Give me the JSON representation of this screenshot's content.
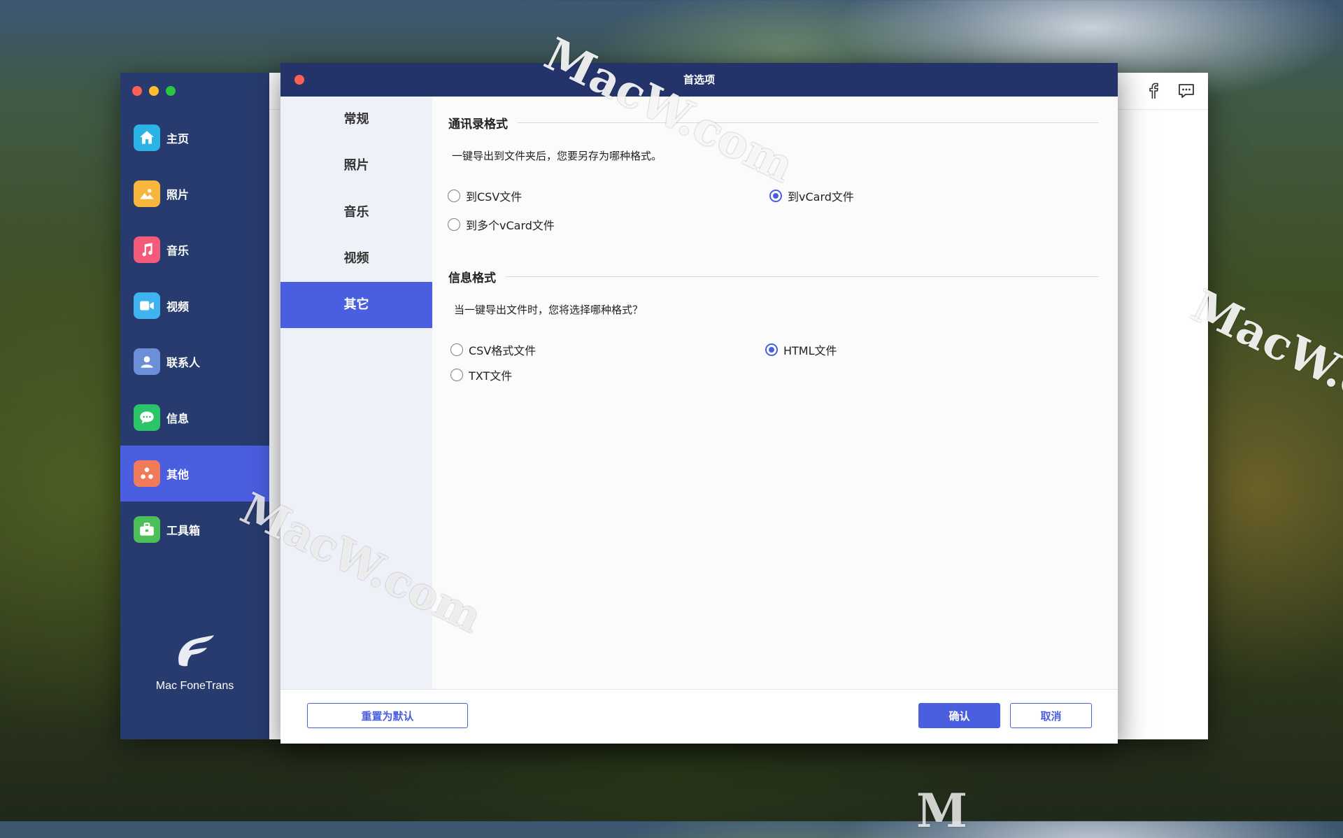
{
  "watermark": "MacW.com",
  "watermark_partial": "M",
  "colors": {
    "accent": "#4a5ee0",
    "sidebar": "#283b6e",
    "titlebar": "#24336a"
  },
  "sidebar": {
    "items": [
      {
        "label": "主页",
        "icon": "home-icon",
        "color": "#2bb3e6",
        "active": false
      },
      {
        "label": "照片",
        "icon": "photo-icon",
        "color": "#f6b73c",
        "active": false
      },
      {
        "label": "音乐",
        "icon": "music-icon",
        "color": "#f45b7a",
        "active": false
      },
      {
        "label": "视频",
        "icon": "video-icon",
        "color": "#3fb2f0",
        "active": false
      },
      {
        "label": "联系人",
        "icon": "contacts-icon",
        "color": "#6d8fd8",
        "active": false
      },
      {
        "label": "信息",
        "icon": "message-icon",
        "color": "#2cc468",
        "active": false
      },
      {
        "label": "其他",
        "icon": "other-icon",
        "color": "#f07a5a",
        "active": true
      },
      {
        "label": "工具箱",
        "icon": "toolbox-icon",
        "color": "#4cbf58",
        "active": false
      }
    ],
    "brand_name": "Mac FoneTrans"
  },
  "top_icons": [
    "facebook-icon",
    "feedback-icon"
  ],
  "dialog": {
    "title": "首选项",
    "tabs": [
      {
        "label": "常规",
        "active": false
      },
      {
        "label": "照片",
        "active": false
      },
      {
        "label": "音乐",
        "active": false
      },
      {
        "label": "视频",
        "active": false
      },
      {
        "label": "其它",
        "active": true
      }
    ],
    "contacts_section": {
      "title": "通讯录格式",
      "description": "一键导出到文件夹后，您要另存为哪种格式。",
      "options": [
        {
          "label": "到CSV文件",
          "checked": false
        },
        {
          "label": "到vCard文件",
          "checked": true
        },
        {
          "label": "到多个vCard文件",
          "checked": false
        }
      ]
    },
    "messages_section": {
      "title": "信息格式",
      "description": "当一键导出文件时，您将选择哪种格式？",
      "options": [
        {
          "label": "CSV格式文件",
          "checked": false
        },
        {
          "label": "HTML文件",
          "checked": true
        },
        {
          "label": "TXT文件",
          "checked": false
        }
      ]
    },
    "footer": {
      "reset_label": "重置为默认",
      "confirm_label": "确认",
      "cancel_label": "取消"
    }
  }
}
